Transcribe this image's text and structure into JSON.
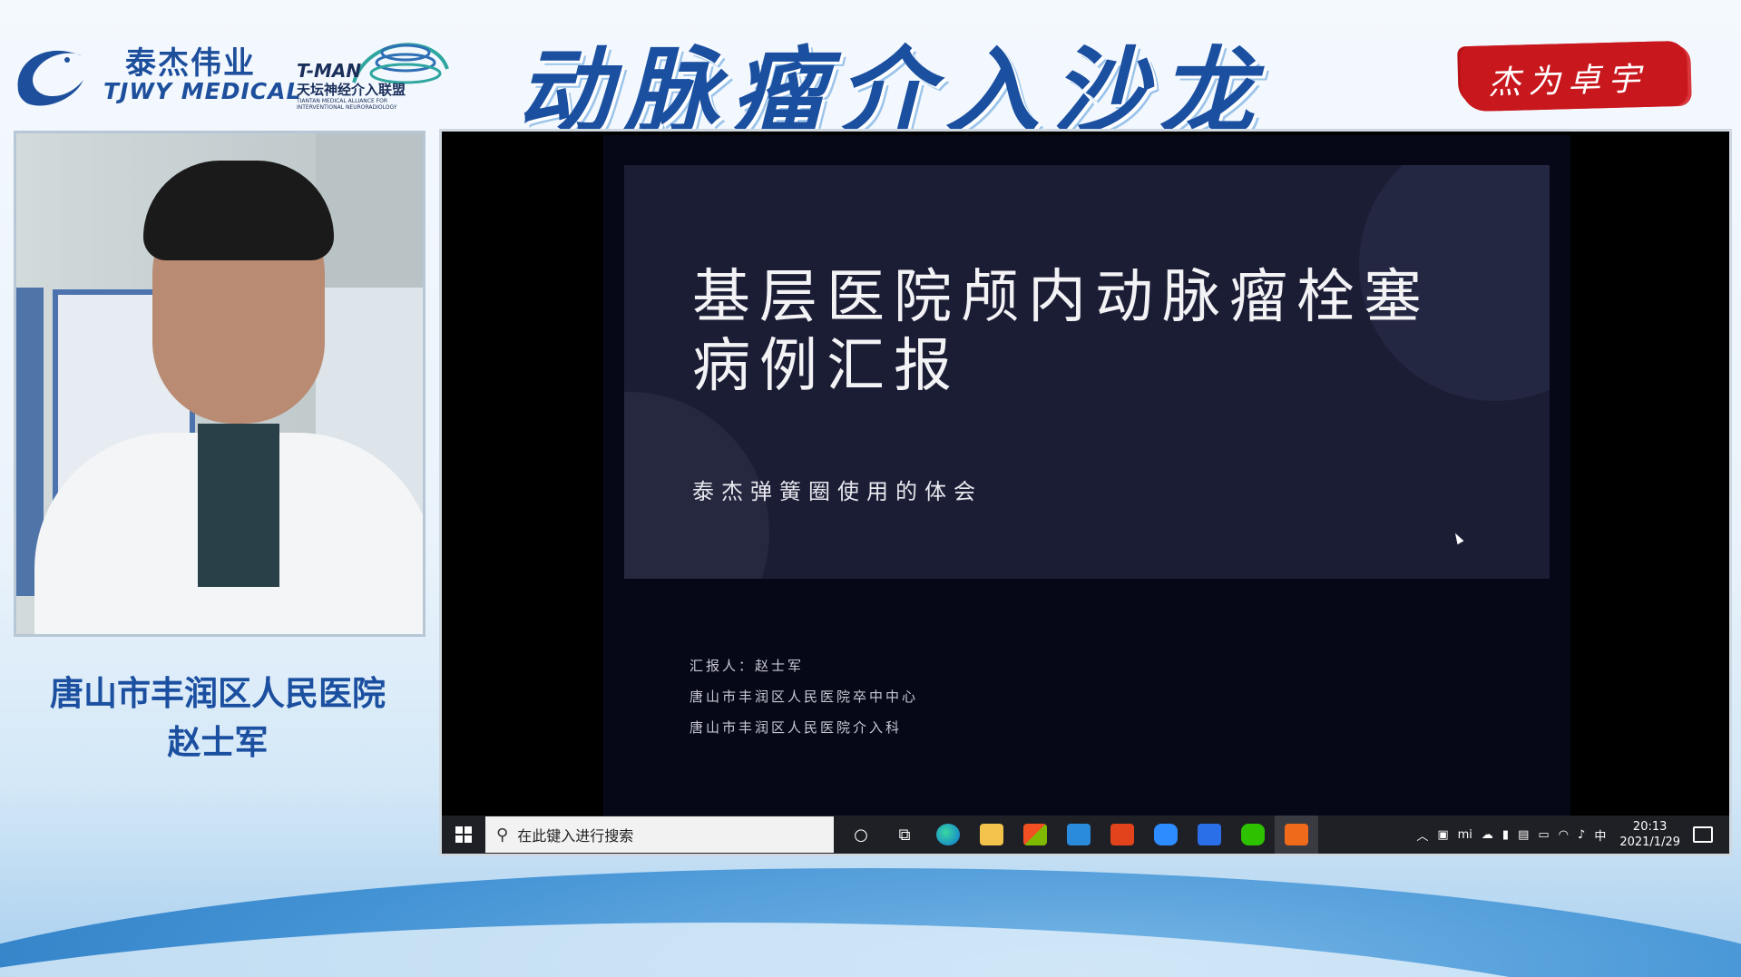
{
  "header": {
    "tjwy_cn": "泰杰伟业",
    "tjwy_en": "TJWY MEDICAL",
    "tman_en": "T-MAN",
    "tman_cn": "天坛神经介入联盟",
    "tman_sub": "TIANTAN MEDICAL ALLIANCE FOR INTERVENTIONAL NEURORADIOLOGY",
    "main_title": "动脉瘤介入沙龙",
    "seal_text": "杰为卓宇"
  },
  "presenter": {
    "hospital": "唐山市丰润区人民医院",
    "name": "赵士军"
  },
  "slide": {
    "title_line1": "基层医院颅内动脉瘤栓塞",
    "title_line2": "病例汇报",
    "subtitle": "泰杰弹簧圈使用的体会",
    "reporter": "汇报人：赵士军",
    "dept1": "唐山市丰润区人民医院卒中中心",
    "dept2": "唐山市丰润区人民医院介入科"
  },
  "taskbar": {
    "search_placeholder": "在此键入进行搜索",
    "tray_ime": "中",
    "tray_mi": "mi",
    "time": "20:13",
    "date": "2021/1/29",
    "apps": [
      "cortana-icon",
      "task-view-icon",
      "edge-icon",
      "file-explorer-icon",
      "store-icon",
      "mail-icon",
      "office-icon",
      "zoom-icon",
      "wps-icon",
      "wechat-icon",
      "media-player-icon"
    ]
  },
  "colors": {
    "brand_blue": "#1b4fa0",
    "seal_red": "#c8171d",
    "slide_bg": "#060818",
    "slide_panel": "#1b1d35",
    "taskbar": "#1f2025"
  }
}
